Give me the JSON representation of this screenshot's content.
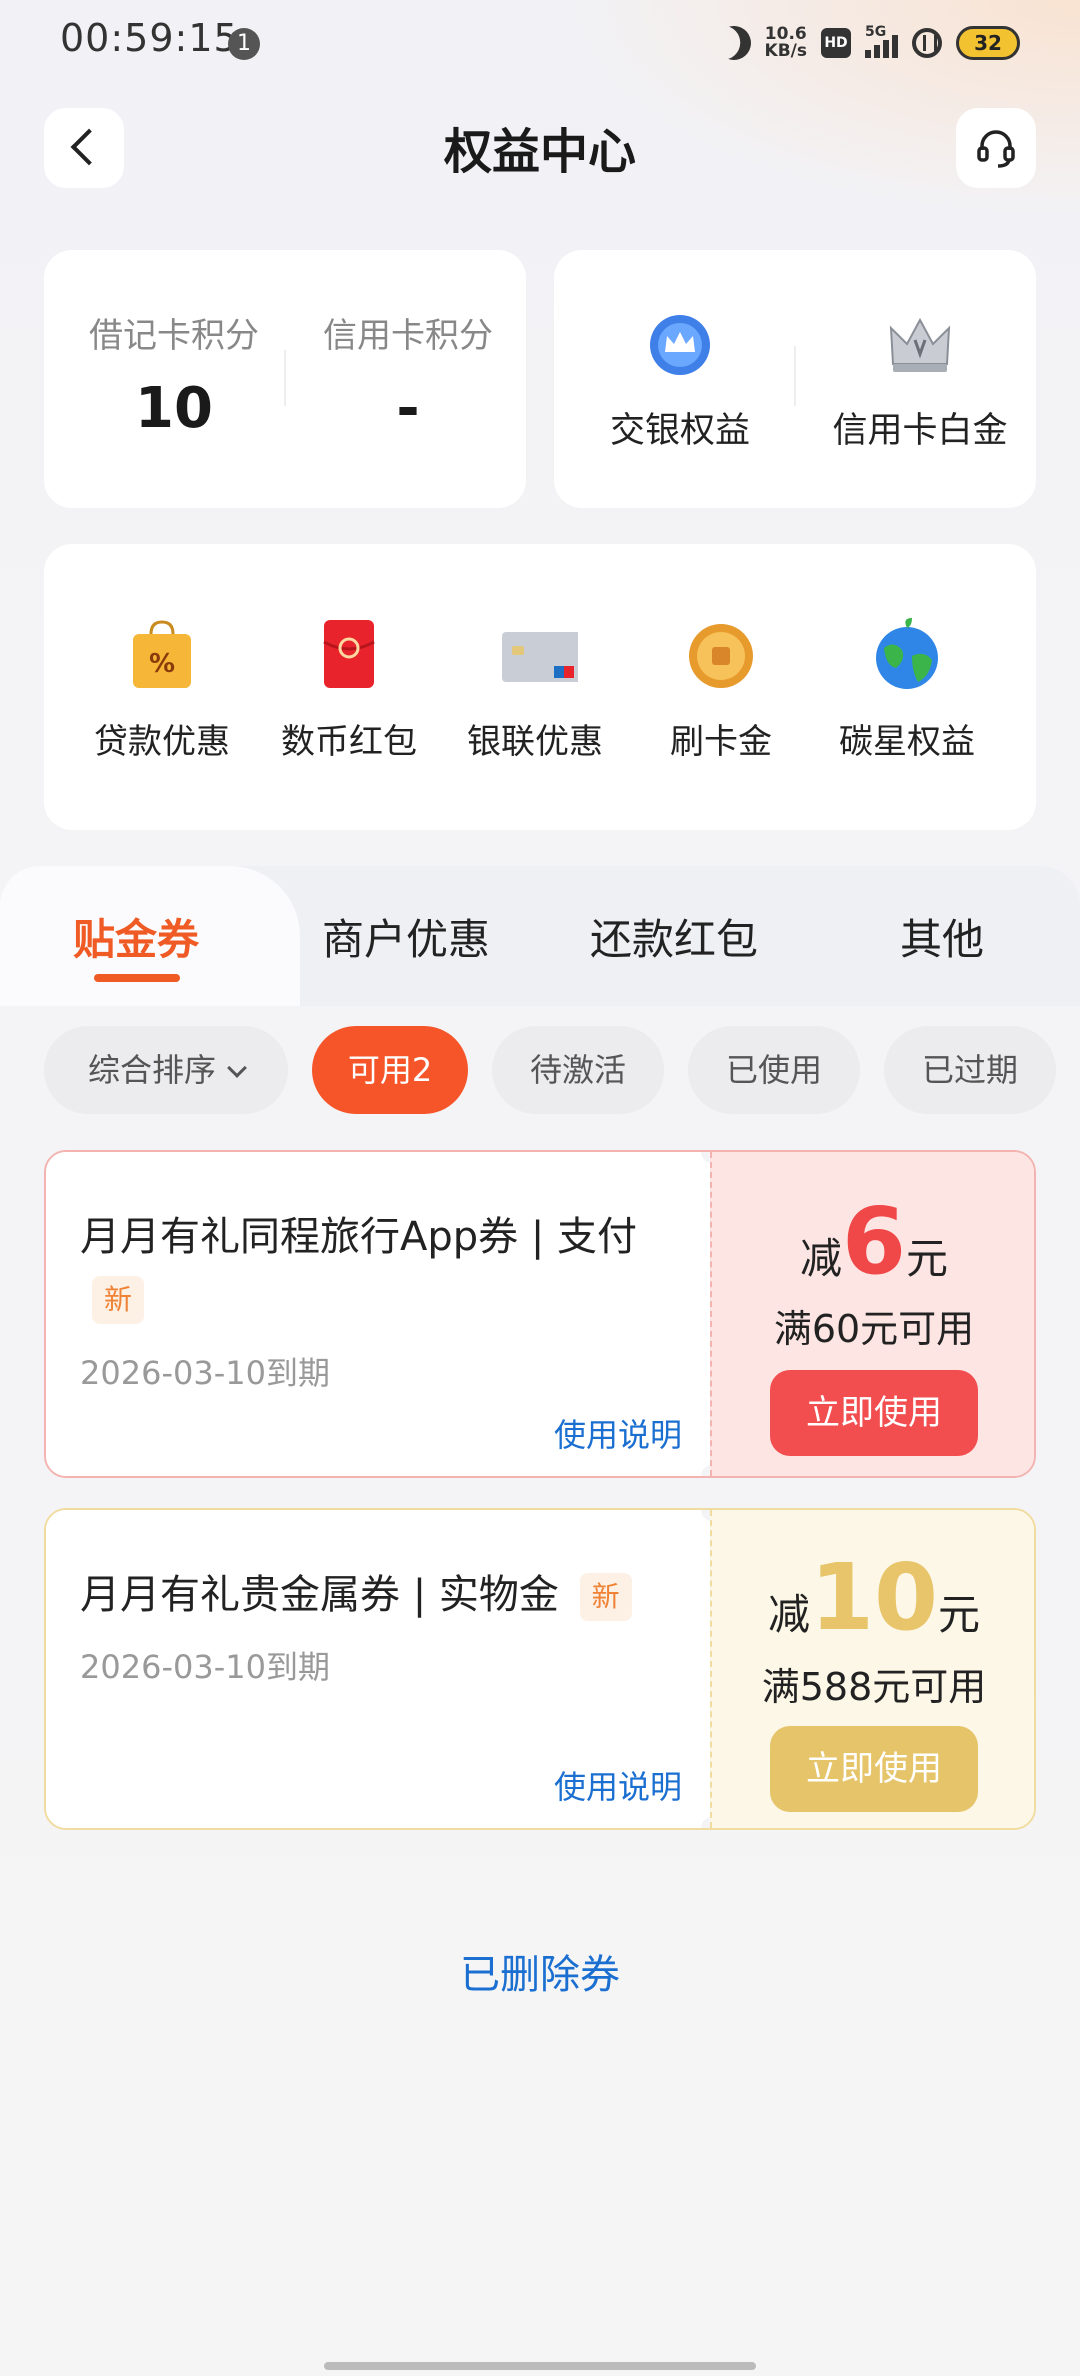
{
  "status_bar": {
    "time": "00:59:15",
    "notification_count": "1",
    "net_speed_value": "10.6",
    "net_speed_unit": "KB/s",
    "hd_label": "HD",
    "signal_label": "5G",
    "battery": "32"
  },
  "header": {
    "title": "权益中心"
  },
  "points": {
    "debit_label": "借记卡积分",
    "debit_value": "10",
    "credit_label": "信用卡积分",
    "credit_value": "-"
  },
  "rights": {
    "items": [
      {
        "label": "交银权益",
        "icon": "crown-badge-icon"
      },
      {
        "label": "信用卡白金",
        "icon": "silver-crown-icon"
      }
    ]
  },
  "services": {
    "items": [
      {
        "label": "贷款优惠",
        "icon": "shopping-bag-icon"
      },
      {
        "label": "数币红包",
        "icon": "red-envelope-icon"
      },
      {
        "label": "银联优惠",
        "icon": "bank-card-icon"
      },
      {
        "label": "刷卡金",
        "icon": "gold-coin-icon"
      },
      {
        "label": "碳星权益",
        "icon": "globe-icon"
      }
    ]
  },
  "tabs": [
    {
      "label": "贴金券",
      "active": true
    },
    {
      "label": "商户优惠",
      "active": false
    },
    {
      "label": "还款红包",
      "active": false
    },
    {
      "label": "其他",
      "active": false
    }
  ],
  "filters": {
    "sort_label": "综合排序",
    "chips": [
      {
        "label": "可用2",
        "active": true
      },
      {
        "label": "待激活",
        "active": false
      },
      {
        "label": "已使用",
        "active": false
      },
      {
        "label": "已过期",
        "active": false
      }
    ]
  },
  "coupons": [
    {
      "title": "月月有礼同程旅行App券 | 支付",
      "tag": "新",
      "expiry": "2026-03-10到期",
      "help": "使用说明",
      "prefix": "减",
      "amount": "6",
      "suffix": "元",
      "condition": "满60元可用",
      "button": "立即使用",
      "theme_color": "#f24d4f"
    },
    {
      "title": "月月有礼贵金属券 | 实物金",
      "tag": "新",
      "expiry": "2026-03-10到期",
      "help": "使用说明",
      "prefix": "减",
      "amount": "10",
      "suffix": "元",
      "condition": "满588元可用",
      "button": "立即使用",
      "theme_color": "#e6c46a"
    }
  ],
  "deleted_link": "已删除券",
  "colors": {
    "accent": "#f05a24",
    "link": "#1a6fd0"
  }
}
